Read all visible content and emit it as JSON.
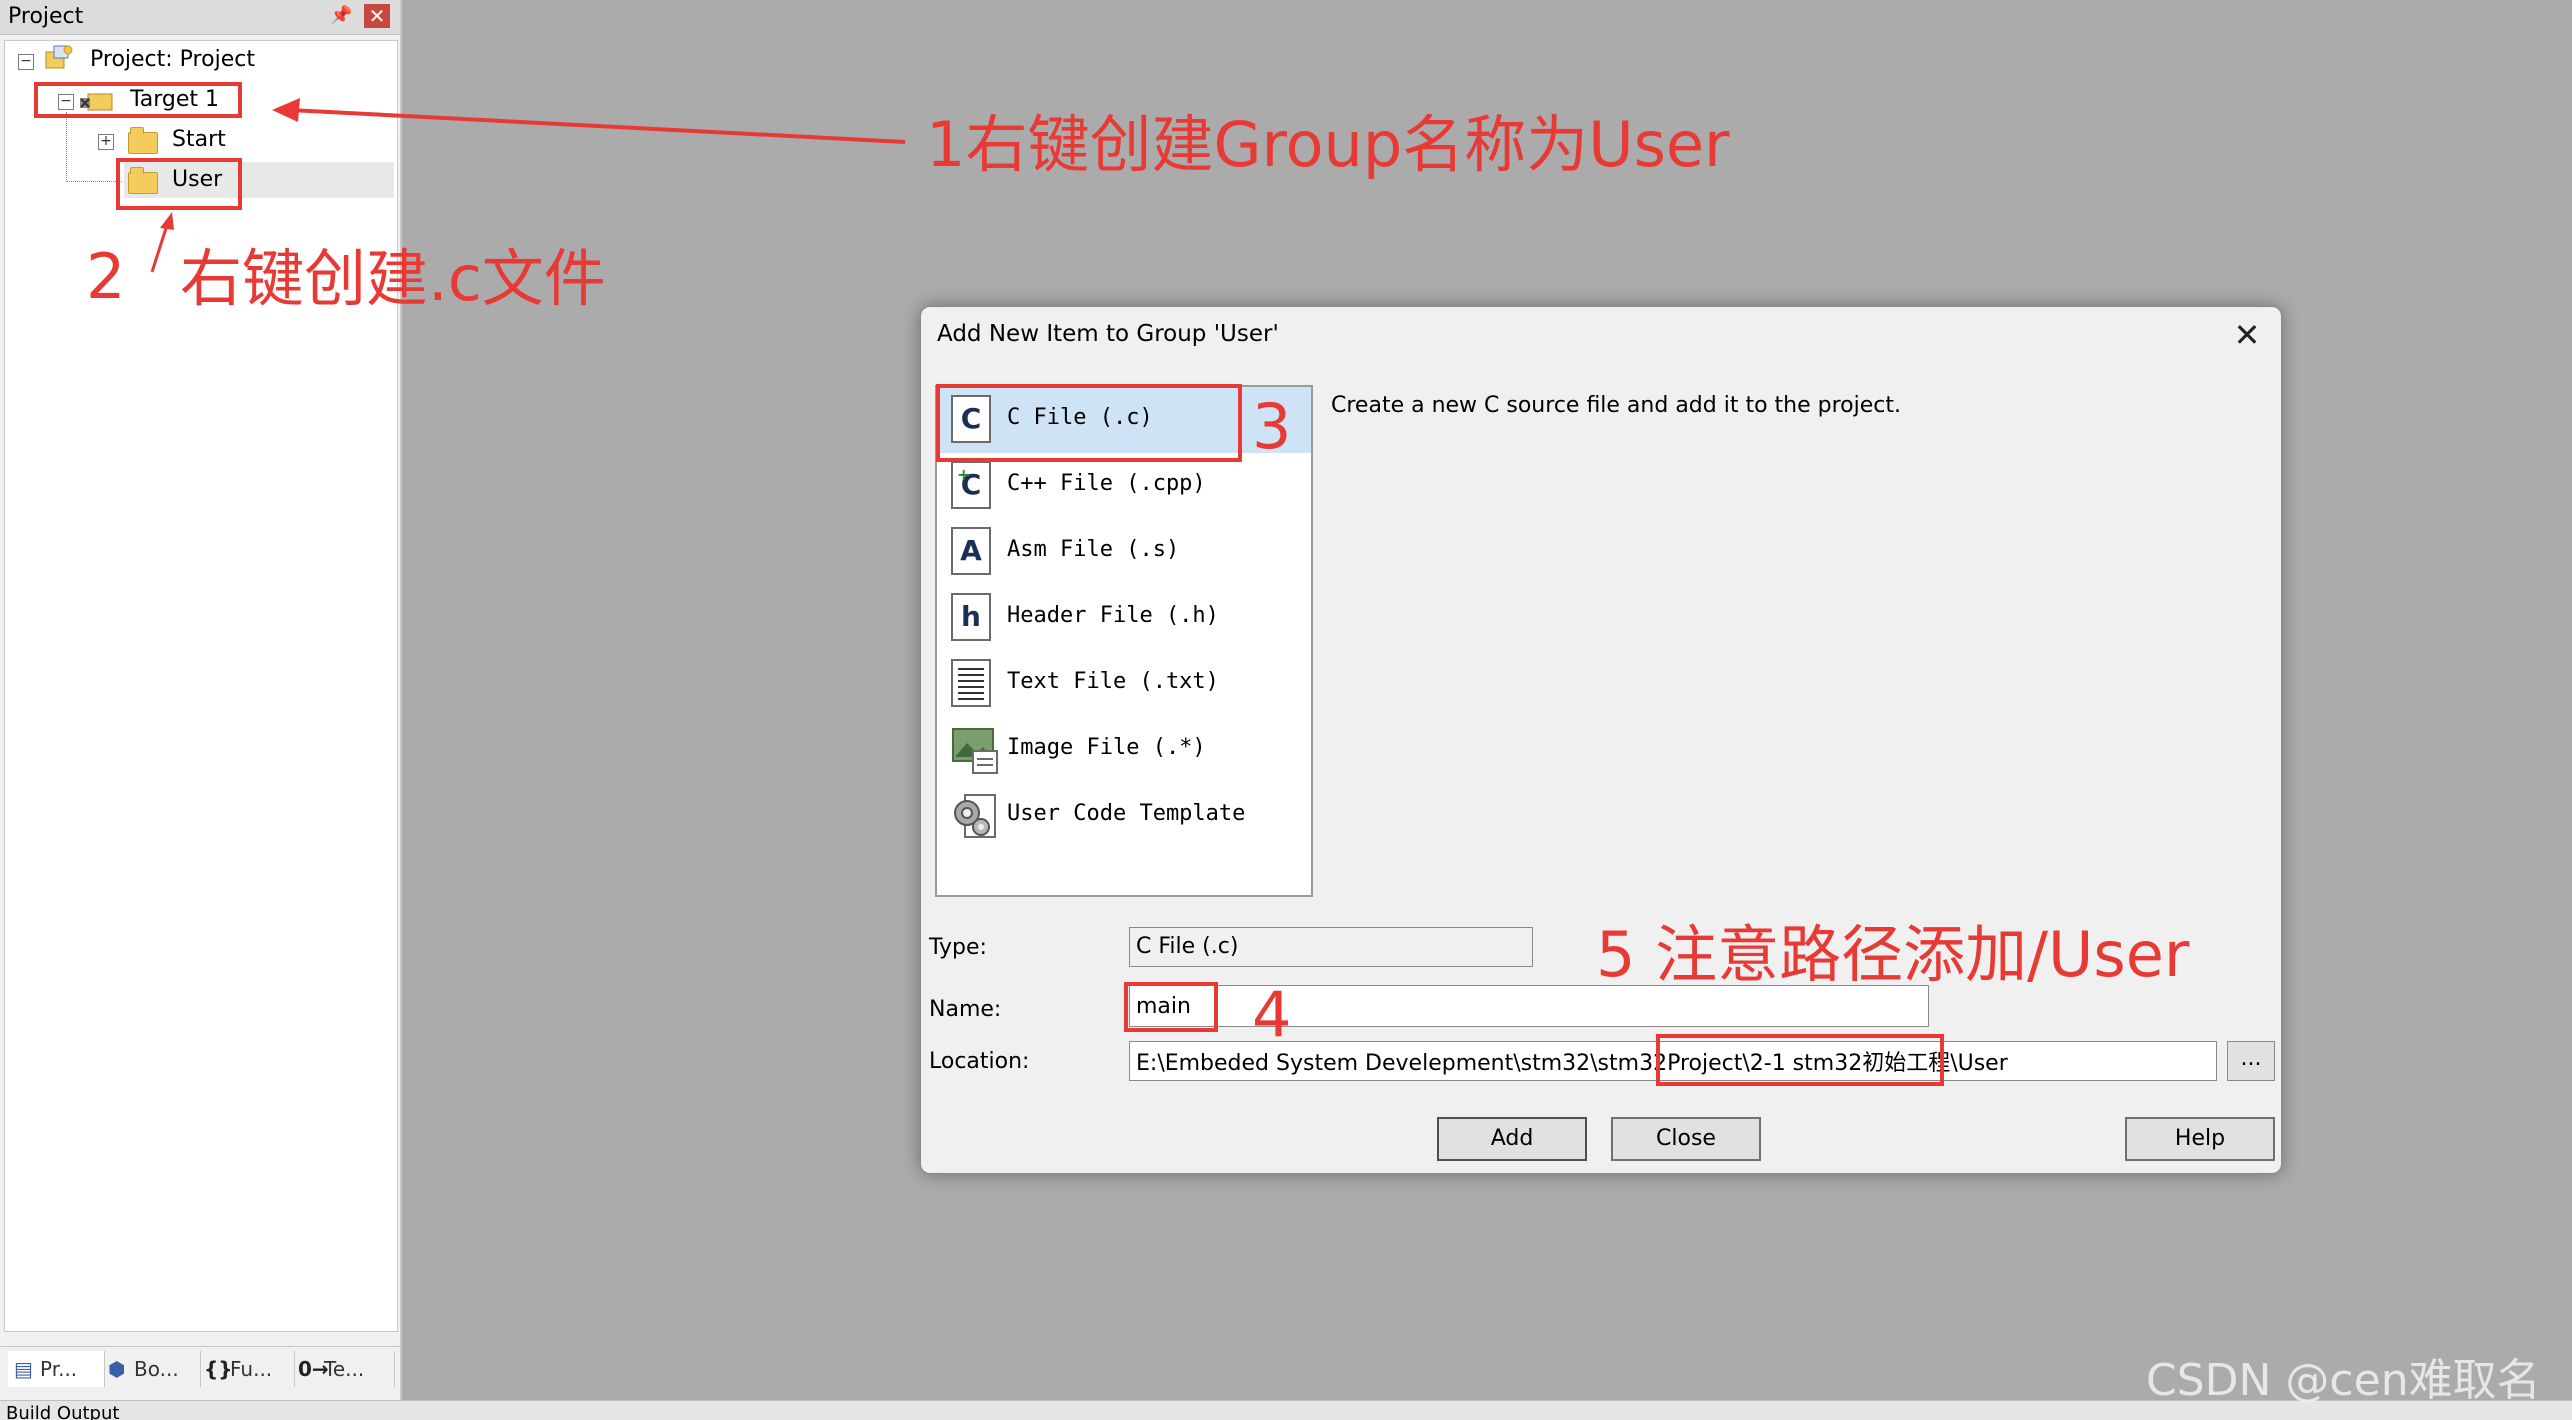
{
  "project_panel": {
    "title": "Project",
    "tree": {
      "root": "Project: Project",
      "target": "Target 1",
      "groups": [
        "Start",
        "User"
      ]
    },
    "tabs": [
      "Pr...",
      "Bo...",
      "Fu...",
      "Te..."
    ],
    "build_output": "Build Output"
  },
  "dialog": {
    "title": "Add New Item to Group 'User'",
    "description": "Create a new C source file and add it to the project.",
    "file_types": [
      {
        "label": "C File (.c)",
        "icon": "c-file-icon"
      },
      {
        "label": "C++ File (.cpp)",
        "icon": "cpp-file-icon"
      },
      {
        "label": "Asm File (.s)",
        "icon": "asm-file-icon"
      },
      {
        "label": "Header File (.h)",
        "icon": "header-file-icon"
      },
      {
        "label": "Text File (.txt)",
        "icon": "text-file-icon"
      },
      {
        "label": "Image File (.*)",
        "icon": "image-file-icon"
      },
      {
        "label": "User Code Template",
        "icon": "template-icon"
      }
    ],
    "type_label": "Type:",
    "type_value": "C File (.c)",
    "name_label": "Name:",
    "name_value": "main",
    "location_label": "Location:",
    "location_value": "E:\\Embeded System Develepment\\stm32\\stm32Project\\2-1 stm32初始工程\\User",
    "browse_label": "...",
    "buttons": {
      "add": "Add",
      "close": "Close",
      "help": "Help"
    }
  },
  "annotations": {
    "step1": "1右键创建Group名称为User",
    "step2_num": "2",
    "step2_text": "右键创建.c文件",
    "step3": "3",
    "step4": "4",
    "step5": "5  注意路径添加/User",
    "color": "#e83a35"
  },
  "watermark": "CSDN @cen难取名"
}
